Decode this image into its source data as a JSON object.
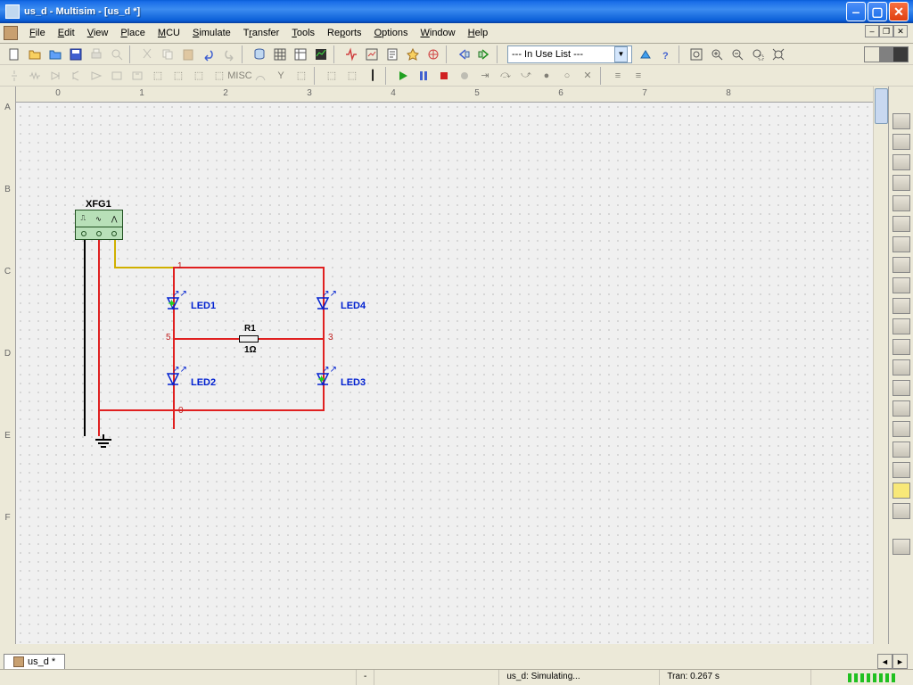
{
  "titlebar": {
    "text": "us_d - Multisim - [us_d *]"
  },
  "menu": {
    "file": "File",
    "edit": "Edit",
    "view": "View",
    "place": "Place",
    "mcu": "MCU",
    "simulate": "Simulate",
    "transfer": "Transfer",
    "tools": "Tools",
    "reports": "Reports",
    "options": "Options",
    "window": "Window",
    "help": "Help"
  },
  "toolbar": {
    "inuse": "--- In Use List ---"
  },
  "ruler_h": [
    "0",
    "1",
    "2",
    "3",
    "4",
    "5",
    "6",
    "7",
    "8"
  ],
  "ruler_v": [
    "A",
    "B",
    "C",
    "D",
    "E",
    "F"
  ],
  "components": {
    "xfg": {
      "ref": "XFG1"
    },
    "led1": "LED1",
    "led2": "LED2",
    "led3": "LED3",
    "led4": "LED4",
    "r1_ref": "R1",
    "r1_val": "1Ω"
  },
  "nodes": {
    "n0": "0",
    "n1": "1",
    "n3": "3",
    "n5": "5"
  },
  "tab": {
    "name": "us_d *"
  },
  "status": {
    "sim": "us_d: Simulating...",
    "tran": "Tran: 0.267 s",
    "dash": "-"
  }
}
